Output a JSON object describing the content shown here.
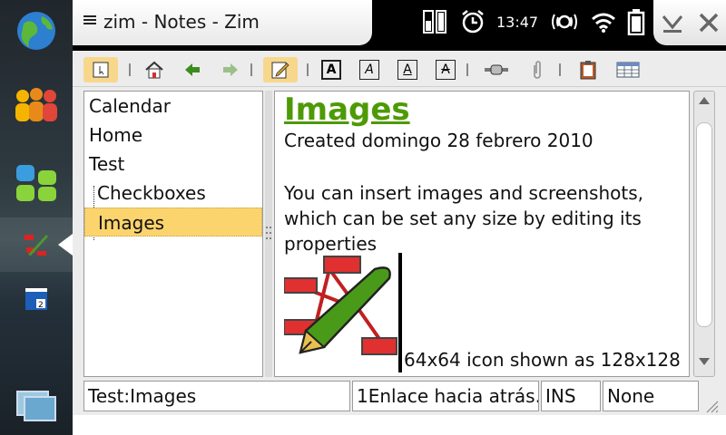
{
  "window": {
    "title": "zim - Notes - Zim"
  },
  "status_area": {
    "clock": "13:47"
  },
  "sidebar": {
    "items": [
      {
        "icon": "globe-icon"
      },
      {
        "icon": "contacts-icon"
      },
      {
        "icon": "applications-icon"
      },
      {
        "icon": "zim-app-icon"
      },
      {
        "icon": "calendar-app-icon"
      },
      {
        "icon": "task-switcher-icon"
      }
    ]
  },
  "toolbar": {
    "buttons": [
      "page-menu-icon",
      "home-icon",
      "back-icon",
      "forward-icon",
      "edit-icon",
      "bold-icon",
      "italic-icon",
      "underline-icon",
      "strike-icon",
      "link-icon",
      "attach-icon",
      "clipboard-icon",
      "table-icon"
    ],
    "format_letters": {
      "bold": "A",
      "italic": "A",
      "underline": "A",
      "strike": "A"
    }
  },
  "tree": {
    "items": [
      {
        "label": "Calendar",
        "level": 0,
        "selected": false
      },
      {
        "label": "Home",
        "level": 0,
        "selected": false
      },
      {
        "label": "Test",
        "level": 0,
        "selected": false
      },
      {
        "label": "Checkboxes",
        "level": 1,
        "selected": false
      },
      {
        "label": "Images",
        "level": 1,
        "selected": true
      }
    ]
  },
  "page": {
    "heading": "Images",
    "created": "Created domingo 28 febrero 2010",
    "body_lines": [
      "You can insert images and screenshots,",
      "which can be set any size by editing its",
      "properties"
    ],
    "image_caption": "64x64 icon shown as 128x128"
  },
  "statusbar": {
    "page_path": "Test:Images",
    "backlinks": "1Enlace hacia atrás...",
    "mode": "INS",
    "style": "None"
  },
  "colors": {
    "heading_green": "#4e9a06",
    "selection_yellow": "#fcd46e",
    "toolbar_active": "#f7d78c"
  }
}
